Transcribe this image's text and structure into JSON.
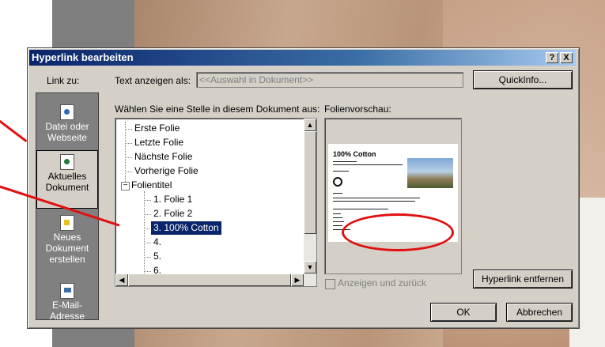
{
  "dialog": {
    "title": "Hyperlink bearbeiten",
    "help_button": "?",
    "close_button": "X",
    "link_to_label": "Link zu:",
    "text_label": "Text anzeigen als:",
    "text_value": "<<Auswahl in Dokument>>",
    "quickinfo_button": "QuickInfo...",
    "select_place_label": "Wählen Sie eine Stelle in diesem Dokument aus:",
    "preview_label": "Folienvorschau:",
    "show_and_return_label": "Anzeigen und zurück",
    "remove_hyperlink_button": "Hyperlink entfernen",
    "ok_button": "OK",
    "cancel_button": "Abbrechen"
  },
  "link_to": [
    {
      "line1": "Datei oder",
      "line2": "Webseite",
      "icon": "web-file-icon"
    },
    {
      "line1": "Aktuelles",
      "line2": "Dokument",
      "icon": "current-document-icon"
    },
    {
      "line1": "Neues",
      "line2": "Dokument",
      "line3": "erstellen",
      "icon": "new-document-icon"
    },
    {
      "line1": "E-Mail-Adresse",
      "icon": "email-icon"
    }
  ],
  "tree": {
    "items": [
      "Erste Folie",
      "Letzte Folie",
      "Nächste Folie",
      "Vorherige Folie"
    ],
    "group": "Folientitel",
    "group_toggle": "−",
    "children": [
      "1. Folie 1",
      "2. Folie 2",
      "3.  100% Cotton",
      "4.",
      "5.",
      "6."
    ],
    "selected": "3.  100% Cotton"
  },
  "preview_slide": {
    "title": "100% Cotton"
  }
}
